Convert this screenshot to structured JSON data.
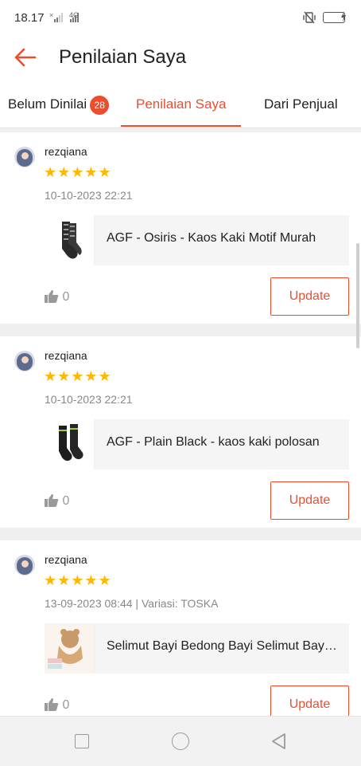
{
  "status_bar": {
    "time": "18.17",
    "signal1": "×",
    "signal2": "4G"
  },
  "header": {
    "title": "Penilaian Saya",
    "back_icon": "arrow-left-icon"
  },
  "tabs": [
    {
      "label": "Belum Dinilai",
      "badge": "28",
      "active": false
    },
    {
      "label": "Penilaian Saya",
      "active": true
    },
    {
      "label": "Dari Penjual",
      "active": false
    }
  ],
  "reviews": [
    {
      "username": "rezqiana",
      "stars": "★★★★★",
      "date": "10-10-2023 22:21",
      "product_name": "AGF - Osiris - Kaos Kaki Motif Murah",
      "likes": "0",
      "button": "Update"
    },
    {
      "username": "rezqiana",
      "stars": "★★★★★",
      "date": "10-10-2023 22:21",
      "product_name": "AGF - Plain Black - kaos kaki polosan",
      "likes": "0",
      "button": "Update"
    },
    {
      "username": "rezqiana",
      "stars": "★★★★★",
      "date": "13-09-2023 08:44 | Variasi: TOSKA",
      "product_name": "Selimut Bayi   Bedong Bayi  Selimut Bayi Topi",
      "likes": "0",
      "button": "Update"
    }
  ],
  "colors": {
    "accent": "#ee4d2d",
    "star": "#ffb800"
  }
}
